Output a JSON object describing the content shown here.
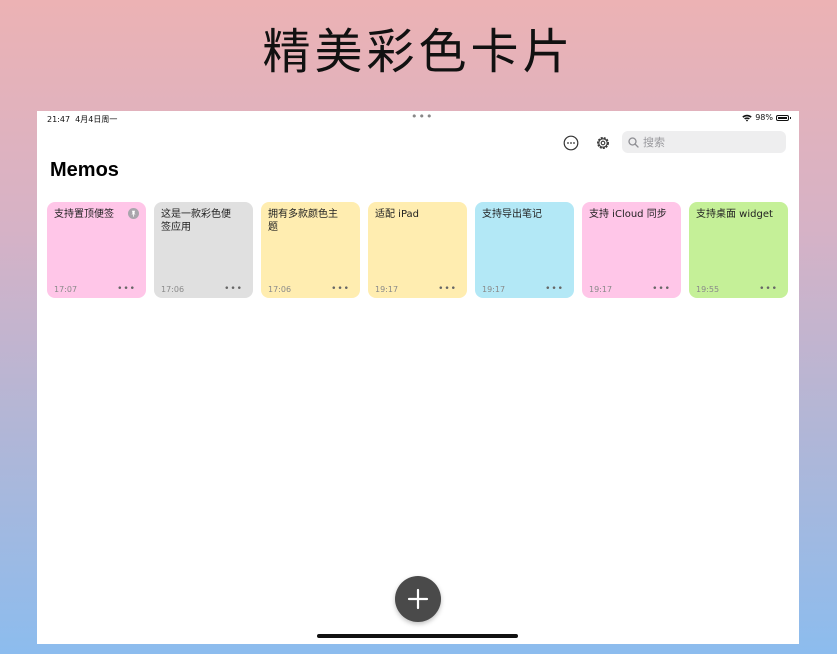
{
  "headline": "精美彩色卡片",
  "status": {
    "time": "21:47",
    "date": "4月4日周一",
    "dots": "•••",
    "battery": "98%",
    "battery_level": 0.98,
    "icons": [
      "wifi-icon",
      "battery-icon"
    ]
  },
  "toolbar": {
    "more_icon": "ellipsis-circle-icon",
    "settings_icon": "gear-icon",
    "search": {
      "placeholder": "搜索",
      "value": "",
      "icon": "search-icon"
    }
  },
  "page_title": "Memos",
  "cards": [
    {
      "text": "支持置顶便签",
      "time": "17:07",
      "color": "#ffc6e8",
      "pinned": true
    },
    {
      "text": "这是一款彩色便签应用",
      "time": "17:06",
      "color": "#e0e0e0",
      "pinned": false
    },
    {
      "text": "拥有多款颜色主题",
      "time": "17:06",
      "color": "#ffedb0",
      "pinned": false
    },
    {
      "text": "适配 iPad",
      "time": "19:17",
      "color": "#ffedb0",
      "pinned": false
    },
    {
      "text": "支持导出笔记",
      "time": "19:17",
      "color": "#b3e8f6",
      "pinned": false
    },
    {
      "text": "支持 iCloud 同步",
      "time": "19:17",
      "color": "#ffc6e8",
      "pinned": false
    },
    {
      "text": "支持桌面 widget",
      "time": "19:55",
      "color": "#c5f098",
      "pinned": false
    }
  ],
  "card_more": "•••",
  "fab_icon": "plus-icon"
}
